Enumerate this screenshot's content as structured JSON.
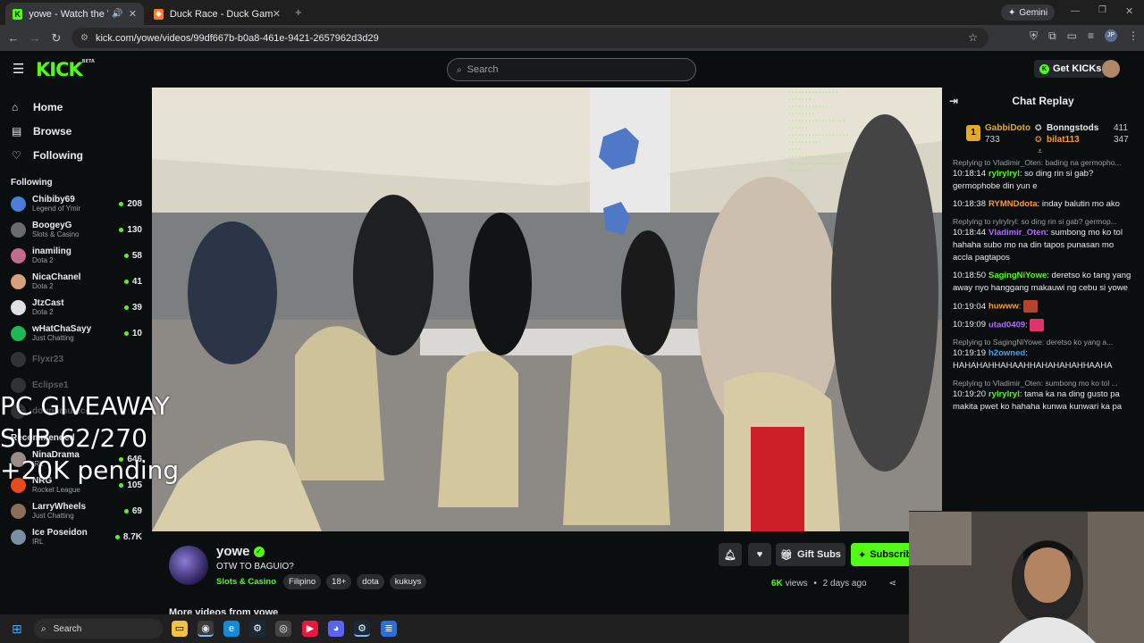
{
  "browser": {
    "tabs": [
      {
        "label": "yowe - Watch the VOD on K",
        "active": true
      },
      {
        "label": "Duck Race - Duck Games",
        "active": false
      }
    ],
    "url": "kick.com/yowe/videos/99df667b-b0a8-461e-9421-2657962d3d29",
    "gemini_label": "Gemini",
    "profile_initials": "JP"
  },
  "header": {
    "logo": "KICK",
    "logo_badge": "BETA",
    "search_placeholder": "Search",
    "get_kicks": "Get KICKs"
  },
  "sidebar": {
    "nav": [
      {
        "label": "Home",
        "icon": "home-icon"
      },
      {
        "label": "Browse",
        "icon": "browse-icon"
      },
      {
        "label": "Following",
        "icon": "heart-icon"
      }
    ],
    "following_title": "Following",
    "following": [
      {
        "name": "Chibiby69",
        "category": "Legend of Ymir",
        "viewers": "208",
        "color": "#4a7fd6"
      },
      {
        "name": "BoogeyG",
        "category": "Slots & Casino",
        "viewers": "130",
        "color": "#6b6b6b"
      },
      {
        "name": "inamiling",
        "category": "Dota 2",
        "viewers": "58",
        "color": "#c26b8a"
      },
      {
        "name": "NicaChanel",
        "category": "Dota 2",
        "viewers": "41",
        "color": "#d4a27a"
      },
      {
        "name": "JtzCast",
        "category": "Dota 2",
        "viewers": "39",
        "color": "#e0e0e0"
      },
      {
        "name": "wHatChaSayy",
        "category": "Just Chatting",
        "viewers": "10",
        "color": "#1db954"
      }
    ],
    "offline": [
      {
        "name": "Flyxr23"
      },
      {
        "name": "Eclipse1"
      },
      {
        "name": "doughmuicce"
      }
    ],
    "recommended_title": "Recommended",
    "recommended": [
      {
        "name": "NinaDrama",
        "category": "IRL",
        "viewers": "646",
        "color": "#9b8d85"
      },
      {
        "name": "NRG",
        "category": "Rocket League",
        "viewers": "105",
        "color": "#e8491d"
      },
      {
        "name": "LarryWheels",
        "category": "Just Chatting",
        "viewers": "69",
        "color": "#8c6d5a"
      },
      {
        "name": "Ice Poseidon",
        "category": "IRL",
        "viewers": "8.7K",
        "color": "#7a8fa3"
      }
    ]
  },
  "overlay_text": [
    "PC GIVEAWAY",
    "SUB 62/270",
    "+20K pending"
  ],
  "chat": {
    "title": "Chat Replay",
    "leaderboard": [
      {
        "rank": "1",
        "name": "GabbiDoto",
        "score": "733"
      },
      {
        "name": "Bonngstods",
        "score": "411"
      },
      {
        "name": "bilat113",
        "score": "347"
      }
    ],
    "messages": [
      {
        "reply": "Replying to Vladimir_Oten: bading na germopho...",
        "time": "10:18:14",
        "user": "rylrylryl",
        "color": "#53fc18",
        "text": "so ding rin si gab? germophobe din yun e"
      },
      {
        "time": "10:18:38",
        "user": "RYMNDdota",
        "color": "#ff9d2e",
        "text": "inday balutin mo ako"
      },
      {
        "reply": "Replying to rylrylryl: so ding rin si gab? germop...",
        "time": "10:18:44",
        "user": "Vladimir_Oten",
        "color": "#b46bff",
        "text": "sumbong mo ko tol hahaha subo mo na din tapos punasan mo accla pagtapos"
      },
      {
        "time": "10:18:50",
        "user": "SagingNiYowe",
        "color": "#53fc18",
        "text": "deretso ko tang yang away nyo hanggang makauwi ng cebu si yowe"
      },
      {
        "time": "10:19:04",
        "user": "huwww",
        "color": "#ff9d2e",
        "text": ""
      },
      {
        "time": "10:19:09",
        "user": "utad0409",
        "color": "#b46bff",
        "text": ""
      },
      {
        "reply": "Replying to SagingNiYowe: deretso ko yang a...",
        "time": "10:19:19",
        "user": "h2owned",
        "color": "#3fa7ff",
        "text": "HAHAHAHHAHAAHHAHAHAHAHHAAHA"
      },
      {
        "reply": "Replying to Vladimir_Oten: sumbong mo ko tol ...",
        "time": "10:19:20",
        "user": "rylrylryl",
        "color": "#53fc18",
        "text": "tama ka na ding gusto pa makita pwet ko hahaha kunwa kunwari ka pa"
      }
    ]
  },
  "channel": {
    "name": "yowe",
    "stream_title": "OTW TO BAGUIO?",
    "category": "Slots & Casino",
    "tags": [
      "Filipino",
      "18+",
      "dota",
      "kukuys"
    ],
    "gift_subs": "Gift Subs",
    "subscribe": "Subscribe",
    "views": "6K",
    "views_label": "views",
    "age": "2 days ago",
    "more_videos": "More videos from yowe"
  },
  "taskbar": {
    "search": "Search"
  }
}
